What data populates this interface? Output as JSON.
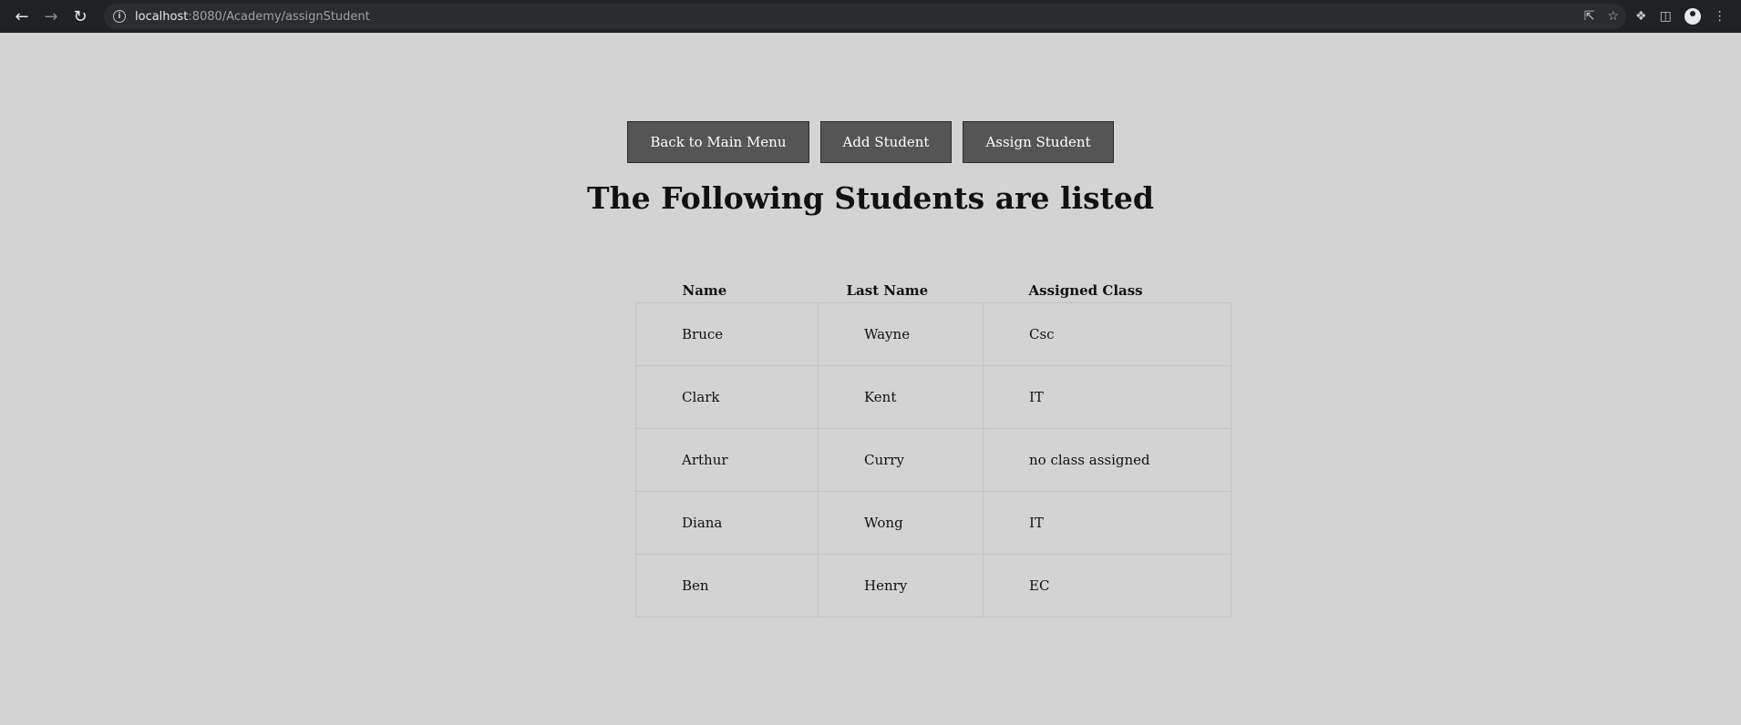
{
  "browser": {
    "url_host": "localhost",
    "url_rest": ":8080/Academy/assignStudent"
  },
  "nav_buttons": {
    "main_menu": "Back to Main Menu",
    "add_student": "Add Student",
    "assign_student": "Assign Student"
  },
  "page_title": "The Following Students are listed",
  "table": {
    "headers": [
      "Name",
      "Last Name",
      "Assigned Class"
    ],
    "rows": [
      [
        "Bruce",
        "Wayne",
        "Csc"
      ],
      [
        "Clark",
        "Kent",
        "IT"
      ],
      [
        "Arthur",
        "Curry",
        "no class assigned"
      ],
      [
        "Diana",
        "Wong",
        "IT"
      ],
      [
        "Ben",
        "Henry",
        "EC"
      ]
    ]
  }
}
